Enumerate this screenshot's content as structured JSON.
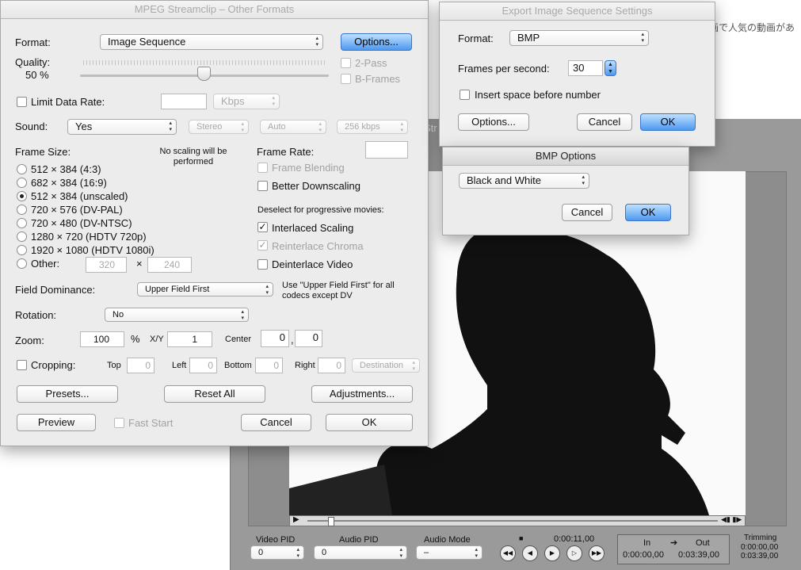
{
  "background": {
    "jp_text": "画で人気の動画があ",
    "fragment_text": "Str"
  },
  "main": {
    "title": "MPEG Streamclip – Other Formats",
    "format_label": "Format:",
    "format_value": "Image Sequence",
    "options_button": "Options...",
    "quality_label": "Quality:",
    "quality_value": "50 %",
    "two_pass": "2-Pass",
    "b_frames": "B-Frames",
    "limit_data_rate": "Limit Data Rate:",
    "kbps": "Kbps",
    "sound_label": "Sound:",
    "sound_value": "Yes",
    "stereo": "Stereo",
    "auto": "Auto",
    "bitrate": "256 kbps",
    "frame_size_label": "Frame Size:",
    "no_scaling_note": "No scaling will be performed",
    "sizes": [
      {
        "label": "512 × 384  (4:3)",
        "selected": false
      },
      {
        "label": "682 × 384  (16:9)",
        "selected": false
      },
      {
        "label": "512 × 384  (unscaled)",
        "selected": true
      },
      {
        "label": "720 × 576  (DV-PAL)",
        "selected": false
      },
      {
        "label": "720 × 480  (DV-NTSC)",
        "selected": false
      },
      {
        "label": "1280 × 720  (HDTV 720p)",
        "selected": false
      },
      {
        "label": "1920 × 1080  (HDTV 1080i)",
        "selected": false
      },
      {
        "label": "Other:",
        "selected": false
      }
    ],
    "other_w": "320",
    "times": "×",
    "other_h": "240",
    "frame_rate_label": "Frame Rate:",
    "frame_blending": "Frame Blending",
    "better_downscaling": "Better Downscaling",
    "deselect_note": "Deselect for progressive movies:",
    "interlaced_scaling": "Interlaced Scaling",
    "reinterlace_chroma": "Reinterlace Chroma",
    "deinterlace_video": "Deinterlace Video",
    "field_dominance_label": "Field Dominance:",
    "field_dominance_value": "Upper Field First",
    "field_note": "Use \"Upper Field First\" for all codecs except DV",
    "rotation_label": "Rotation:",
    "rotation_value": "No",
    "zoom_label": "Zoom:",
    "zoom_value": "100",
    "percent": "%",
    "xy_label": "X/Y",
    "xy_value": "1",
    "center_label": "Center",
    "center_x": "0",
    "comma": ",",
    "center_y": "0",
    "cropping_label": "Cropping:",
    "top_label": "Top",
    "top_value": "0",
    "left_label": "Left",
    "left_value": "0",
    "bottom_label": "Bottom",
    "bottom_value": "0",
    "right_label": "Right",
    "right_value": "0",
    "destination": "Destination",
    "presets_button": "Presets...",
    "reset_button": "Reset All",
    "adjustments_button": "Adjustments...",
    "preview_button": "Preview",
    "fast_start": "Fast Start",
    "cancel_button": "Cancel",
    "ok_button": "OK"
  },
  "export": {
    "title": "Export Image Sequence Settings",
    "format_label": "Format:",
    "format_value": "BMP",
    "fps_label": "Frames per second:",
    "fps_value": "30",
    "insert_space": "Insert space before number",
    "options_button": "Options...",
    "cancel_button": "Cancel",
    "ok_button": "OK"
  },
  "bmp": {
    "title": "BMP Options",
    "mode_value": "Black and White",
    "cancel_button": "Cancel",
    "ok_button": "OK"
  },
  "player": {
    "video_pid_label": "Video PID",
    "video_pid_value": "0",
    "audio_pid_label": "Audio PID",
    "audio_pid_value": "0",
    "audio_mode_label": "Audio Mode",
    "audio_mode_value": "–",
    "timecode": "0:00:11,00",
    "in_label": "In",
    "out_label": "Out",
    "in_time": "0:00:00,00",
    "out_time": "0:03:39,00",
    "trimming_label": "Trimming",
    "trim_in": "0:00:00,00",
    "trim_out": "0:03:39,00"
  }
}
